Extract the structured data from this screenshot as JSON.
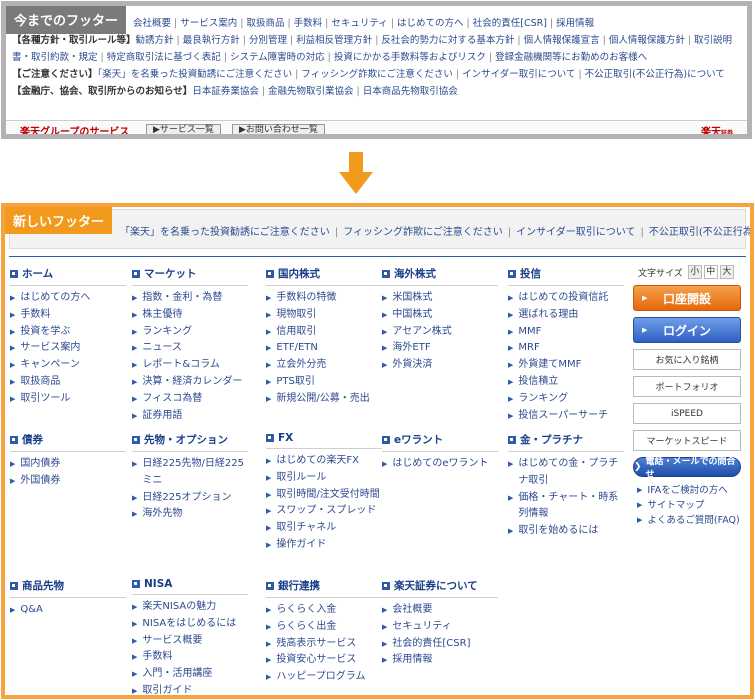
{
  "old_footer": {
    "label": "今までのフッター",
    "row1_links": [
      "会社概要",
      "サービス案内",
      "取扱商品",
      "手数料",
      "セキュリティ",
      "はじめての方へ",
      "社会的責任[CSR]",
      "採用情報"
    ],
    "row2_head": "【各種方針・取引ルール等】",
    "row2_links": [
      "勧誘方針",
      "最良執行方針",
      "分別管理",
      "利益相反管理方針",
      "反社会的勢力に対する基本方針",
      "個人情報保護宣言",
      "個人情報保護方針",
      "取引説明書・取引約款・規定",
      "特定商取引法に基づく表記",
      "システム障害時の対応",
      "投資にかかる手数料等およびリスク",
      "登録金融機関等にお勤めのお客様へ"
    ],
    "row3_head": "【ご注意ください】",
    "row3_links": [
      "「楽天」を名乗った投資勧誘にご注意ください",
      "フィッシング詐欺にご注意ください",
      "インサイダー取引について",
      "不公正取引(不公正行為)について"
    ],
    "row4_head": "【金融庁、協会、取引所からのお知らせ】",
    "row4_links": [
      "日本証券業協会",
      "金融先物取引業協会",
      "日本商品先物取引協会"
    ],
    "bottom_group": "楽天グループのサービス",
    "bottom_btn1": "サービス一覧",
    "bottom_btn2": "お問い合わせ一覧",
    "bottom_logo": "楽天",
    "bottom_logo_sub": "証券"
  },
  "new_footer": {
    "label": "新しいフッター",
    "notice_links": [
      "「楽天」を名乗った投資勧誘にご注意ください",
      "フィッシング詐欺にご注意ください",
      "インサイダー取引について",
      "不公正取引(不公正行為)について"
    ],
    "sections": [
      {
        "title": "ホーム",
        "items": [
          "はじめての方へ",
          "手数料",
          "投資を学ぶ",
          "サービス案内",
          "キャンペーン",
          "取扱商品",
          "取引ツール"
        ]
      },
      {
        "title": "マーケット",
        "items": [
          "指数・金利・為替",
          "株主優待",
          "ランキング",
          "ニュース",
          "レポート&コラム",
          "決算・経済カレンダー",
          "フィスコ為替",
          "証券用語"
        ]
      },
      {
        "title": "国内株式",
        "items": [
          "手数料の特徴",
          "現物取引",
          "信用取引",
          "ETF/ETN",
          "立会外分売",
          "PTS取引",
          "新規公開/公募・売出"
        ]
      },
      {
        "title": "海外株式",
        "items": [
          "米国株式",
          "中国株式",
          "アセアン株式",
          "海外ETF",
          "外貨決済"
        ]
      },
      {
        "title": "投信",
        "items": [
          "はじめての投資信託",
          "選ばれる理由",
          "MMF",
          "MRF",
          "外貨建てMMF",
          "投信積立",
          "ランキング",
          "投信スーパーサーチ"
        ]
      },
      {
        "title": "債券",
        "items": [
          "国内債券",
          "外国債券"
        ]
      },
      {
        "title": "先物・オプション",
        "items": [
          "日経225先物/日経225ミニ",
          "日経225オプション",
          "海外先物"
        ]
      },
      {
        "title": "FX",
        "items": [
          "はじめての楽天FX",
          "取引ルール",
          "取引時間/注文受付時間",
          "スワップ・スプレッド",
          "取引チャネル",
          "操作ガイド"
        ]
      },
      {
        "title": "eワラント",
        "items": [
          "はじめてのeワラント"
        ]
      },
      {
        "title": "金・プラチナ",
        "items": [
          "はじめての金・プラチナ取引",
          "価格・チャート・時系列情報",
          "取引を始めるには"
        ]
      },
      {
        "title": "商品先物",
        "items": [
          "Q&A"
        ]
      },
      {
        "title": "NISA",
        "items": [
          "楽天NISAの魅力",
          "NISAをはじめるには",
          "サービス概要",
          "手数料",
          "入門・活用講座",
          "取引ガイド"
        ]
      },
      {
        "title": "銀行連携",
        "items": [
          "らくらく入金",
          "らくらく出金",
          "残高表示サービス",
          "投資安心サービス",
          "ハッピープログラム"
        ]
      },
      {
        "title": "楽天証券について",
        "items": [
          "会社概要",
          "セキュリティ",
          "社会的責任[CSR]",
          "採用情報"
        ]
      }
    ],
    "side": {
      "font_size_label": "文字サイズ",
      "font_sizes": [
        "小",
        "中",
        "大"
      ],
      "open_account": "口座開設",
      "login": "ログイン",
      "gray_buttons": [
        "お気に入り銘柄",
        "ポートフォリオ",
        "iSPEED",
        "マーケットスピード"
      ],
      "contact": "電話・メールでの問合せ",
      "links": [
        "IFAをご検討の方へ",
        "サイトマップ",
        "よくあるご質問(FAQ)"
      ]
    }
  },
  "colors": {
    "old_border": "#b3b3b3",
    "new_border": "#f7a23e",
    "arrow": "#f29a1d",
    "link": "#2c4a8f",
    "heading": "#1a3f8a"
  }
}
